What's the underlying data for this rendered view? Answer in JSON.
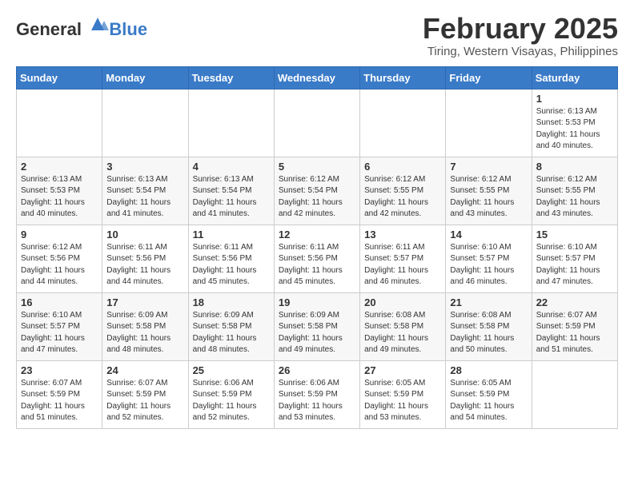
{
  "header": {
    "logo_general": "General",
    "logo_blue": "Blue",
    "month": "February 2025",
    "location": "Tiring, Western Visayas, Philippines"
  },
  "weekdays": [
    "Sunday",
    "Monday",
    "Tuesday",
    "Wednesday",
    "Thursday",
    "Friday",
    "Saturday"
  ],
  "weeks": [
    [
      {
        "day": "",
        "info": ""
      },
      {
        "day": "",
        "info": ""
      },
      {
        "day": "",
        "info": ""
      },
      {
        "day": "",
        "info": ""
      },
      {
        "day": "",
        "info": ""
      },
      {
        "day": "",
        "info": ""
      },
      {
        "day": "1",
        "info": "Sunrise: 6:13 AM\nSunset: 5:53 PM\nDaylight: 11 hours\nand 40 minutes."
      }
    ],
    [
      {
        "day": "2",
        "info": "Sunrise: 6:13 AM\nSunset: 5:53 PM\nDaylight: 11 hours\nand 40 minutes."
      },
      {
        "day": "3",
        "info": "Sunrise: 6:13 AM\nSunset: 5:54 PM\nDaylight: 11 hours\nand 41 minutes."
      },
      {
        "day": "4",
        "info": "Sunrise: 6:13 AM\nSunset: 5:54 PM\nDaylight: 11 hours\nand 41 minutes."
      },
      {
        "day": "5",
        "info": "Sunrise: 6:12 AM\nSunset: 5:54 PM\nDaylight: 11 hours\nand 42 minutes."
      },
      {
        "day": "6",
        "info": "Sunrise: 6:12 AM\nSunset: 5:55 PM\nDaylight: 11 hours\nand 42 minutes."
      },
      {
        "day": "7",
        "info": "Sunrise: 6:12 AM\nSunset: 5:55 PM\nDaylight: 11 hours\nand 43 minutes."
      },
      {
        "day": "8",
        "info": "Sunrise: 6:12 AM\nSunset: 5:55 PM\nDaylight: 11 hours\nand 43 minutes."
      }
    ],
    [
      {
        "day": "9",
        "info": "Sunrise: 6:12 AM\nSunset: 5:56 PM\nDaylight: 11 hours\nand 44 minutes."
      },
      {
        "day": "10",
        "info": "Sunrise: 6:11 AM\nSunset: 5:56 PM\nDaylight: 11 hours\nand 44 minutes."
      },
      {
        "day": "11",
        "info": "Sunrise: 6:11 AM\nSunset: 5:56 PM\nDaylight: 11 hours\nand 45 minutes."
      },
      {
        "day": "12",
        "info": "Sunrise: 6:11 AM\nSunset: 5:56 PM\nDaylight: 11 hours\nand 45 minutes."
      },
      {
        "day": "13",
        "info": "Sunrise: 6:11 AM\nSunset: 5:57 PM\nDaylight: 11 hours\nand 46 minutes."
      },
      {
        "day": "14",
        "info": "Sunrise: 6:10 AM\nSunset: 5:57 PM\nDaylight: 11 hours\nand 46 minutes."
      },
      {
        "day": "15",
        "info": "Sunrise: 6:10 AM\nSunset: 5:57 PM\nDaylight: 11 hours\nand 47 minutes."
      }
    ],
    [
      {
        "day": "16",
        "info": "Sunrise: 6:10 AM\nSunset: 5:57 PM\nDaylight: 11 hours\nand 47 minutes."
      },
      {
        "day": "17",
        "info": "Sunrise: 6:09 AM\nSunset: 5:58 PM\nDaylight: 11 hours\nand 48 minutes."
      },
      {
        "day": "18",
        "info": "Sunrise: 6:09 AM\nSunset: 5:58 PM\nDaylight: 11 hours\nand 48 minutes."
      },
      {
        "day": "19",
        "info": "Sunrise: 6:09 AM\nSunset: 5:58 PM\nDaylight: 11 hours\nand 49 minutes."
      },
      {
        "day": "20",
        "info": "Sunrise: 6:08 AM\nSunset: 5:58 PM\nDaylight: 11 hours\nand 49 minutes."
      },
      {
        "day": "21",
        "info": "Sunrise: 6:08 AM\nSunset: 5:58 PM\nDaylight: 11 hours\nand 50 minutes."
      },
      {
        "day": "22",
        "info": "Sunrise: 6:07 AM\nSunset: 5:59 PM\nDaylight: 11 hours\nand 51 minutes."
      }
    ],
    [
      {
        "day": "23",
        "info": "Sunrise: 6:07 AM\nSunset: 5:59 PM\nDaylight: 11 hours\nand 51 minutes."
      },
      {
        "day": "24",
        "info": "Sunrise: 6:07 AM\nSunset: 5:59 PM\nDaylight: 11 hours\nand 52 minutes."
      },
      {
        "day": "25",
        "info": "Sunrise: 6:06 AM\nSunset: 5:59 PM\nDaylight: 11 hours\nand 52 minutes."
      },
      {
        "day": "26",
        "info": "Sunrise: 6:06 AM\nSunset: 5:59 PM\nDaylight: 11 hours\nand 53 minutes."
      },
      {
        "day": "27",
        "info": "Sunrise: 6:05 AM\nSunset: 5:59 PM\nDaylight: 11 hours\nand 53 minutes."
      },
      {
        "day": "28",
        "info": "Sunrise: 6:05 AM\nSunset: 5:59 PM\nDaylight: 11 hours\nand 54 minutes."
      },
      {
        "day": "",
        "info": ""
      }
    ]
  ]
}
